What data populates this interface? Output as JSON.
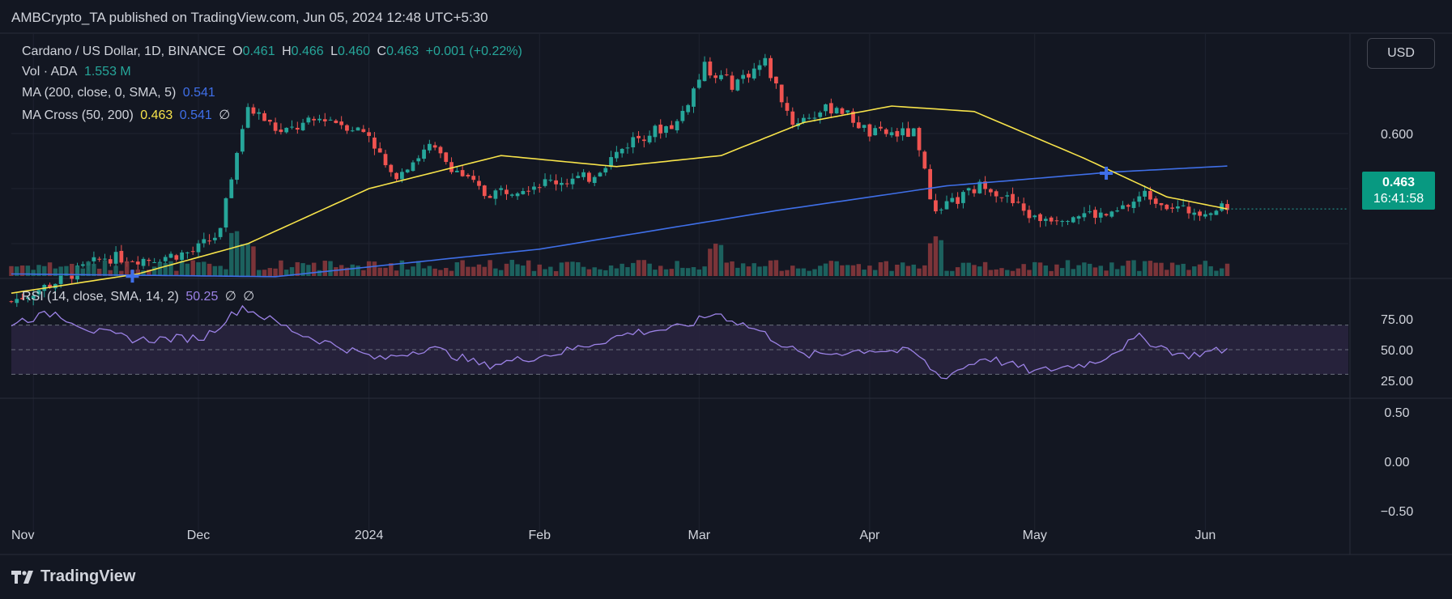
{
  "header": {
    "publisher_line": "AMBCrypto_TA published on TradingView.com, Jun 05, 2024 12:48 UTC+5:30"
  },
  "legend": {
    "symbol": "Cardano / US Dollar, 1D, BINANCE",
    "o_label": "O",
    "o_value": "0.461",
    "h_label": "H",
    "h_value": "0.466",
    "l_label": "L",
    "l_value": "0.460",
    "c_label": "C",
    "c_value": "0.463",
    "change": "+0.001 (+0.22%)",
    "vol_label": "Vol · ADA",
    "vol_value": "1.553 M",
    "ma_label": "MA (200, close, 0, SMA, 5)",
    "ma_value": "0.541",
    "macross_label": "MA Cross (50, 200)",
    "macross_fast": "0.463",
    "macross_slow": "0.541",
    "macross_extra": "∅",
    "rsi_label": "RSI (14, close, SMA, 14, 2)",
    "rsi_value": "50.25",
    "rsi_extra1": "∅",
    "rsi_extra2": "∅"
  },
  "toolbar": {
    "currency": "USD"
  },
  "price_label": {
    "value": "0.463",
    "countdown": "16:41:58"
  },
  "branding": {
    "name": "TradingView"
  },
  "colors": {
    "background": "#131722",
    "grid": "#1f2330",
    "up": "#26a69a",
    "down": "#ef5350",
    "ma50": "#f7e34a",
    "ma200": "#3f6fe8",
    "rsi": "#9c82e6",
    "rsi_band": "#2a2540",
    "text": "#d1d4dc"
  },
  "chart_data": {
    "type": "candlestick",
    "symbol": "ADA/USD",
    "interval": "1D",
    "price_axis": {
      "ticks": [
        "0.600"
      ],
      "current": 0.463
    },
    "rsi_axis": {
      "ticks": [
        "75.00",
        "50.00",
        "25.00"
      ],
      "overbought": 70,
      "oversold": 30
    },
    "lower_axis": {
      "ticks": [
        "0.50",
        "0.00",
        "−0.50"
      ]
    },
    "x_ticks": [
      "Nov",
      "Dec",
      "2024",
      "Feb",
      "Mar",
      "Apr",
      "May",
      "Jun"
    ],
    "price_anchors": [
      {
        "date": "2023-10-28",
        "close": 0.295
      },
      {
        "date": "2023-11-05",
        "close": 0.33
      },
      {
        "date": "2023-11-14",
        "close": 0.375
      },
      {
        "date": "2023-11-22",
        "close": 0.372
      },
      {
        "date": "2023-11-30",
        "close": 0.385
      },
      {
        "date": "2023-12-05",
        "close": 0.42
      },
      {
        "date": "2023-12-08",
        "close": 0.575
      },
      {
        "date": "2023-12-10",
        "close": 0.65
      },
      {
        "date": "2023-12-16",
        "close": 0.6
      },
      {
        "date": "2023-12-24",
        "close": 0.63
      },
      {
        "date": "2024-01-01",
        "close": 0.6
      },
      {
        "date": "2024-01-05",
        "close": 0.52
      },
      {
        "date": "2024-01-12",
        "close": 0.575
      },
      {
        "date": "2024-01-22",
        "close": 0.49
      },
      {
        "date": "2024-02-01",
        "close": 0.51
      },
      {
        "date": "2024-02-10",
        "close": 0.52
      },
      {
        "date": "2024-02-18",
        "close": 0.59
      },
      {
        "date": "2024-02-26",
        "close": 0.62
      },
      {
        "date": "2024-03-02",
        "close": 0.72
      },
      {
        "date": "2024-03-07",
        "close": 0.69
      },
      {
        "date": "2024-03-13",
        "close": 0.73
      },
      {
        "date": "2024-03-18",
        "close": 0.62
      },
      {
        "date": "2024-03-26",
        "close": 0.65
      },
      {
        "date": "2024-04-01",
        "close": 0.6
      },
      {
        "date": "2024-04-09",
        "close": 0.6
      },
      {
        "date": "2024-04-13",
        "close": 0.455
      },
      {
        "date": "2024-04-22",
        "close": 0.51
      },
      {
        "date": "2024-05-01",
        "close": 0.445
      },
      {
        "date": "2024-05-10",
        "close": 0.455
      },
      {
        "date": "2024-05-15",
        "close": 0.45
      },
      {
        "date": "2024-05-21",
        "close": 0.49
      },
      {
        "date": "2024-05-28",
        "close": 0.46
      },
      {
        "date": "2024-06-05",
        "close": 0.463
      }
    ],
    "ma50_anchors": [
      {
        "date": "2023-10-28",
        "value": 0.31
      },
      {
        "date": "2023-11-20",
        "value": 0.345
      },
      {
        "date": "2023-12-10",
        "value": 0.4
      },
      {
        "date": "2024-01-01",
        "value": 0.5
      },
      {
        "date": "2024-01-25",
        "value": 0.56
      },
      {
        "date": "2024-02-15",
        "value": 0.54
      },
      {
        "date": "2024-03-05",
        "value": 0.56
      },
      {
        "date": "2024-03-20",
        "value": 0.62
      },
      {
        "date": "2024-04-05",
        "value": 0.65
      },
      {
        "date": "2024-04-20",
        "value": 0.64
      },
      {
        "date": "2024-05-10",
        "value": 0.555
      },
      {
        "date": "2024-05-25",
        "value": 0.485
      },
      {
        "date": "2024-06-05",
        "value": 0.463
      }
    ],
    "ma200_anchors": [
      {
        "date": "2023-10-28",
        "value": 0.345
      },
      {
        "date": "2023-12-15",
        "value": 0.34
      },
      {
        "date": "2024-02-01",
        "value": 0.39
      },
      {
        "date": "2024-03-15",
        "value": 0.46
      },
      {
        "date": "2024-04-15",
        "value": 0.505
      },
      {
        "date": "2024-05-15",
        "value": 0.53
      },
      {
        "date": "2024-06-05",
        "value": 0.541
      }
    ],
    "crosses": [
      {
        "date": "2023-11-19",
        "value": 0.341
      },
      {
        "date": "2024-05-14",
        "value": 0.528
      }
    ],
    "volume_spikes": [
      {
        "date": "2023-12-08",
        "weight": 1.2
      },
      {
        "date": "2023-12-10",
        "weight": 0.9
      },
      {
        "date": "2024-03-04",
        "weight": 0.8
      },
      {
        "date": "2024-04-13",
        "weight": 1.0
      }
    ],
    "rsi_anchors": [
      {
        "date": "2023-10-28",
        "value": 72
      },
      {
        "date": "2023-11-05",
        "value": 80
      },
      {
        "date": "2023-11-12",
        "value": 65
      },
      {
        "date": "2023-11-20",
        "value": 58
      },
      {
        "date": "2023-12-02",
        "value": 60
      },
      {
        "date": "2023-12-09",
        "value": 85
      },
      {
        "date": "2023-12-20",
        "value": 62
      },
      {
        "date": "2024-01-03",
        "value": 42
      },
      {
        "date": "2024-01-12",
        "value": 52
      },
      {
        "date": "2024-01-22",
        "value": 37
      },
      {
        "date": "2024-02-05",
        "value": 48
      },
      {
        "date": "2024-02-18",
        "value": 64
      },
      {
        "date": "2024-02-27",
        "value": 68
      },
      {
        "date": "2024-03-04",
        "value": 80
      },
      {
        "date": "2024-03-12",
        "value": 65
      },
      {
        "date": "2024-03-20",
        "value": 45
      },
      {
        "date": "2024-04-01",
        "value": 50
      },
      {
        "date": "2024-04-09",
        "value": 48
      },
      {
        "date": "2024-04-14",
        "value": 27
      },
      {
        "date": "2024-04-22",
        "value": 44
      },
      {
        "date": "2024-05-01",
        "value": 32
      },
      {
        "date": "2024-05-12",
        "value": 40
      },
      {
        "date": "2024-05-20",
        "value": 60
      },
      {
        "date": "2024-05-28",
        "value": 45
      },
      {
        "date": "2024-06-05",
        "value": 50.25
      }
    ]
  }
}
